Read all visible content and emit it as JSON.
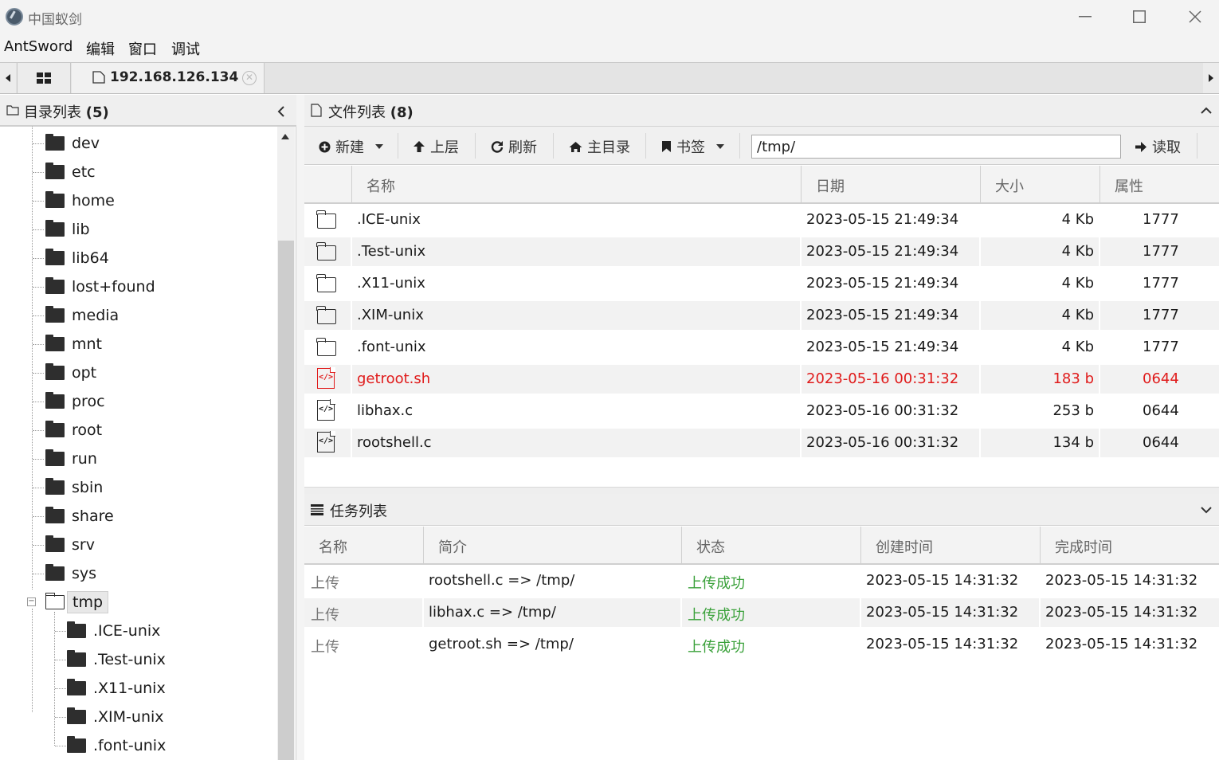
{
  "window": {
    "title": "中国蚁剑"
  },
  "menu": [
    "AntSword",
    "编辑",
    "窗口",
    "调试"
  ],
  "tabs": {
    "host": "192.168.126.134"
  },
  "left": {
    "title": "目录列表",
    "count": "(5)",
    "dirs": [
      "dev",
      "etc",
      "home",
      "lib",
      "lib64",
      "lost+found",
      "media",
      "mnt",
      "opt",
      "proc",
      "root",
      "run",
      "sbin",
      "share",
      "srv",
      "sys"
    ],
    "selected": "tmp",
    "children": [
      ".ICE-unix",
      ".Test-unix",
      ".X11-unix",
      ".XIM-unix",
      ".font-unix"
    ]
  },
  "files": {
    "title": "文件列表",
    "count": "(8)",
    "toolbar": {
      "new": "新建",
      "up": "上层",
      "refresh": "刷新",
      "home": "主目录",
      "bookmark": "书签",
      "read": "读取"
    },
    "path": "/tmp/",
    "headers": {
      "name": "名称",
      "date": "日期",
      "size": "大小",
      "attr": "属性"
    },
    "rows": [
      {
        "type": "folder",
        "name": ".ICE-unix",
        "date": "2023-05-15 21:49:34",
        "size": "4 Kb",
        "attr": "1777"
      },
      {
        "type": "folder",
        "name": ".Test-unix",
        "date": "2023-05-15 21:49:34",
        "size": "4 Kb",
        "attr": "1777"
      },
      {
        "type": "folder",
        "name": ".X11-unix",
        "date": "2023-05-15 21:49:34",
        "size": "4 Kb",
        "attr": "1777"
      },
      {
        "type": "folder",
        "name": ".XIM-unix",
        "date": "2023-05-15 21:49:34",
        "size": "4 Kb",
        "attr": "1777"
      },
      {
        "type": "folder",
        "name": ".font-unix",
        "date": "2023-05-15 21:49:34",
        "size": "4 Kb",
        "attr": "1777"
      },
      {
        "type": "code",
        "name": "getroot.sh",
        "date": "2023-05-16 00:31:32",
        "size": "183 b",
        "attr": "0644"
      },
      {
        "type": "code",
        "name": "libhax.c",
        "date": "2023-05-16 00:31:32",
        "size": "253 b",
        "attr": "0644"
      },
      {
        "type": "code",
        "name": "rootshell.c",
        "date": "2023-05-16 00:31:32",
        "size": "134 b",
        "attr": "0644"
      }
    ]
  },
  "tasks": {
    "title": "任务列表",
    "headers": {
      "name": "名称",
      "desc": "简介",
      "status": "状态",
      "created": "创建时间",
      "done": "完成时间"
    },
    "rows": [
      {
        "name": "上传",
        "desc": "rootshell.c => /tmp/",
        "status": "上传成功",
        "created": "2023-05-15 14:31:32",
        "done": "2023-05-15 14:31:32"
      },
      {
        "name": "上传",
        "desc": "libhax.c => /tmp/",
        "status": "上传成功",
        "created": "2023-05-15 14:31:32",
        "done": "2023-05-15 14:31:32"
      },
      {
        "name": "上传",
        "desc": "getroot.sh => /tmp/",
        "status": "上传成功",
        "created": "2023-05-15 14:31:32",
        "done": "2023-05-15 14:31:32"
      }
    ]
  }
}
